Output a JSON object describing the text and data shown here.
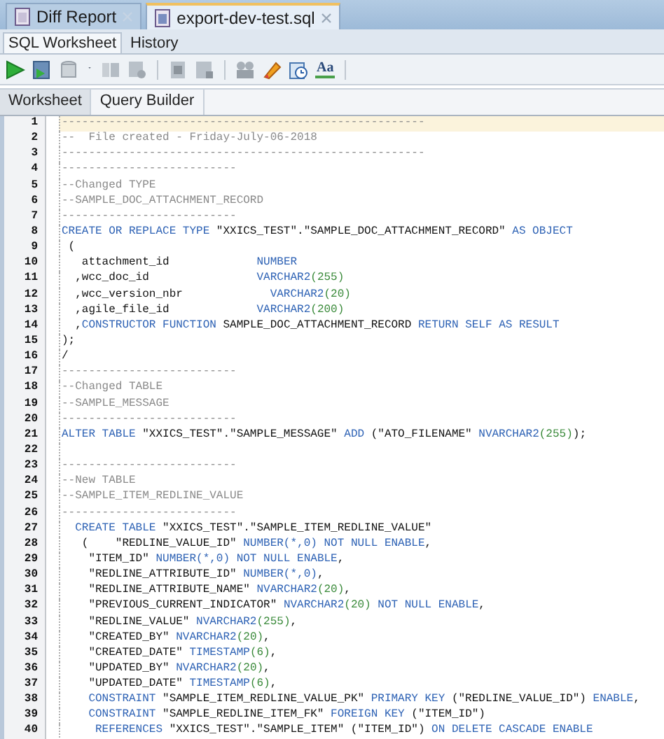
{
  "document_tabs": [
    {
      "label": "Diff Report",
      "selected": false
    },
    {
      "label": "export-dev-test.sql",
      "selected": true
    }
  ],
  "view_tabs": [
    {
      "label": "SQL Worksheet",
      "selected": true
    },
    {
      "label": "History",
      "selected": false
    }
  ],
  "toolbar": {
    "format_icon_text": "Aa"
  },
  "editor_tabs": [
    {
      "label": "Worksheet",
      "selected": true
    },
    {
      "label": "Query Builder",
      "selected": false
    }
  ],
  "editor": {
    "lines": [
      {
        "number": "1",
        "current": true,
        "tokens": [
          {
            "kind": "comment",
            "text": "------------------------------------------------------"
          }
        ]
      },
      {
        "number": "2",
        "current": false,
        "tokens": [
          {
            "kind": "comment",
            "text": "--  File created - Friday-July-06-2018"
          }
        ]
      },
      {
        "number": "3",
        "current": false,
        "tokens": [
          {
            "kind": "comment",
            "text": "------------------------------------------------------"
          }
        ]
      },
      {
        "number": "4",
        "current": false,
        "tokens": [
          {
            "kind": "comment",
            "text": "--------------------------"
          }
        ]
      },
      {
        "number": "5",
        "current": false,
        "tokens": [
          {
            "kind": "comment",
            "text": "--Changed TYPE"
          }
        ]
      },
      {
        "number": "6",
        "current": false,
        "tokens": [
          {
            "kind": "comment",
            "text": "--SAMPLE_DOC_ATTACHMENT_RECORD"
          }
        ]
      },
      {
        "number": "7",
        "current": false,
        "tokens": [
          {
            "kind": "comment",
            "text": "--------------------------"
          }
        ]
      },
      {
        "number": "8",
        "current": false,
        "tokens": [
          {
            "kind": "keyword",
            "text": "CREATE OR REPLACE TYPE "
          },
          {
            "kind": "plain",
            "text": "\"XXICS_TEST\".\"SAMPLE_DOC_ATTACHMENT_RECORD\" "
          },
          {
            "kind": "keyword",
            "text": "AS OBJECT"
          }
        ]
      },
      {
        "number": "9",
        "current": false,
        "tokens": [
          {
            "kind": "plain",
            "text": " ("
          }
        ]
      },
      {
        "number": "10",
        "current": false,
        "tokens": [
          {
            "kind": "plain",
            "text": "   attachment_id             "
          },
          {
            "kind": "keyword",
            "text": "NUMBER"
          }
        ]
      },
      {
        "number": "11",
        "current": false,
        "tokens": [
          {
            "kind": "plain",
            "text": "  ,wcc_doc_id                "
          },
          {
            "kind": "keyword",
            "text": "VARCHAR2"
          },
          {
            "kind": "number",
            "text": "(255)"
          }
        ]
      },
      {
        "number": "12",
        "current": false,
        "tokens": [
          {
            "kind": "plain",
            "text": "  ,wcc_version_nbr             "
          },
          {
            "kind": "keyword",
            "text": "VARCHAR2"
          },
          {
            "kind": "number",
            "text": "(20)"
          }
        ]
      },
      {
        "number": "13",
        "current": false,
        "tokens": [
          {
            "kind": "plain",
            "text": "  ,agile_file_id             "
          },
          {
            "kind": "keyword",
            "text": "VARCHAR2"
          },
          {
            "kind": "number",
            "text": "(200)"
          }
        ]
      },
      {
        "number": "14",
        "current": false,
        "tokens": [
          {
            "kind": "plain",
            "text": "  ,"
          },
          {
            "kind": "keyword",
            "text": "CONSTRUCTOR FUNCTION "
          },
          {
            "kind": "plain",
            "text": "SAMPLE_DOC_ATTACHMENT_RECORD "
          },
          {
            "kind": "keyword",
            "text": "RETURN SELF AS RESULT"
          }
        ]
      },
      {
        "number": "15",
        "current": false,
        "tokens": [
          {
            "kind": "plain",
            "text": ");"
          }
        ]
      },
      {
        "number": "16",
        "current": false,
        "tokens": [
          {
            "kind": "plain",
            "text": "/"
          }
        ]
      },
      {
        "number": "17",
        "current": false,
        "tokens": [
          {
            "kind": "comment",
            "text": "--------------------------"
          }
        ]
      },
      {
        "number": "18",
        "current": false,
        "tokens": [
          {
            "kind": "comment",
            "text": "--Changed TABLE"
          }
        ]
      },
      {
        "number": "19",
        "current": false,
        "tokens": [
          {
            "kind": "comment",
            "text": "--SAMPLE_MESSAGE"
          }
        ]
      },
      {
        "number": "20",
        "current": false,
        "tokens": [
          {
            "kind": "comment",
            "text": "--------------------------"
          }
        ]
      },
      {
        "number": "21",
        "current": false,
        "tokens": [
          {
            "kind": "keyword",
            "text": "ALTER TABLE "
          },
          {
            "kind": "plain",
            "text": "\"XXICS_TEST\".\"SAMPLE_MESSAGE\" "
          },
          {
            "kind": "keyword",
            "text": "ADD "
          },
          {
            "kind": "plain",
            "text": "(\"ATO_FILENAME\" "
          },
          {
            "kind": "keyword",
            "text": "NVARCHAR2"
          },
          {
            "kind": "number",
            "text": "(255)"
          },
          {
            "kind": "plain",
            "text": ");"
          }
        ]
      },
      {
        "number": "22",
        "current": false
      },
      {
        "number": "23",
        "current": false,
        "tokens": [
          {
            "kind": "comment",
            "text": "--------------------------"
          }
        ]
      },
      {
        "number": "24",
        "current": false,
        "tokens": [
          {
            "kind": "comment",
            "text": "--New TABLE"
          }
        ]
      },
      {
        "number": "25",
        "current": false,
        "tokens": [
          {
            "kind": "comment",
            "text": "--SAMPLE_ITEM_REDLINE_VALUE"
          }
        ]
      },
      {
        "number": "26",
        "current": false,
        "tokens": [
          {
            "kind": "comment",
            "text": "--------------------------"
          }
        ]
      },
      {
        "number": "27",
        "current": false,
        "tokens": [
          {
            "kind": "keyword",
            "text": "  CREATE TABLE "
          },
          {
            "kind": "plain",
            "text": "\"XXICS_TEST\".\"SAMPLE_ITEM_REDLINE_VALUE\""
          }
        ]
      },
      {
        "number": "28",
        "current": false,
        "tokens": [
          {
            "kind": "plain",
            "text": "   (    \"REDLINE_VALUE_ID\" "
          },
          {
            "kind": "keyword",
            "text": "NUMBER(*,0) NOT NULL ENABLE"
          },
          {
            "kind": "plain",
            "text": ","
          }
        ]
      },
      {
        "number": "29",
        "current": false,
        "tokens": [
          {
            "kind": "plain",
            "text": "    \"ITEM_ID\" "
          },
          {
            "kind": "keyword",
            "text": "NUMBER(*,0) NOT NULL ENABLE"
          },
          {
            "kind": "plain",
            "text": ","
          }
        ]
      },
      {
        "number": "30",
        "current": false,
        "tokens": [
          {
            "kind": "plain",
            "text": "    \"REDLINE_ATTRIBUTE_ID\" "
          },
          {
            "kind": "keyword",
            "text": "NUMBER(*,0)"
          },
          {
            "kind": "plain",
            "text": ","
          }
        ]
      },
      {
        "number": "31",
        "current": false,
        "tokens": [
          {
            "kind": "plain",
            "text": "    \"REDLINE_ATTRIBUTE_NAME\" "
          },
          {
            "kind": "keyword",
            "text": "NVARCHAR2"
          },
          {
            "kind": "number",
            "text": "(20)"
          },
          {
            "kind": "plain",
            "text": ","
          }
        ]
      },
      {
        "number": "32",
        "current": false,
        "tokens": [
          {
            "kind": "plain",
            "text": "    \"PREVIOUS_CURRENT_INDICATOR\" "
          },
          {
            "kind": "keyword",
            "text": "NVARCHAR2"
          },
          {
            "kind": "number",
            "text": "(20)"
          },
          {
            "kind": "keyword",
            "text": " NOT NULL ENABLE"
          },
          {
            "kind": "plain",
            "text": ","
          }
        ]
      },
      {
        "number": "33",
        "current": false,
        "tokens": [
          {
            "kind": "plain",
            "text": "    \"REDLINE_VALUE\" "
          },
          {
            "kind": "keyword",
            "text": "NVARCHAR2"
          },
          {
            "kind": "number",
            "text": "(255)"
          },
          {
            "kind": "plain",
            "text": ","
          }
        ]
      },
      {
        "number": "34",
        "current": false,
        "tokens": [
          {
            "kind": "plain",
            "text": "    \"CREATED_BY\" "
          },
          {
            "kind": "keyword",
            "text": "NVARCHAR2"
          },
          {
            "kind": "number",
            "text": "(20)"
          },
          {
            "kind": "plain",
            "text": ","
          }
        ]
      },
      {
        "number": "35",
        "current": false,
        "tokens": [
          {
            "kind": "plain",
            "text": "    \"CREATED_DATE\" "
          },
          {
            "kind": "keyword",
            "text": "TIMESTAMP"
          },
          {
            "kind": "number",
            "text": "(6)"
          },
          {
            "kind": "plain",
            "text": ","
          }
        ]
      },
      {
        "number": "36",
        "current": false,
        "tokens": [
          {
            "kind": "plain",
            "text": "    \"UPDATED_BY\" "
          },
          {
            "kind": "keyword",
            "text": "NVARCHAR2"
          },
          {
            "kind": "number",
            "text": "(20)"
          },
          {
            "kind": "plain",
            "text": ","
          }
        ]
      },
      {
        "number": "37",
        "current": false,
        "tokens": [
          {
            "kind": "plain",
            "text": "    \"UPDATED_DATE\" "
          },
          {
            "kind": "keyword",
            "text": "TIMESTAMP"
          },
          {
            "kind": "number",
            "text": "(6)"
          },
          {
            "kind": "plain",
            "text": ","
          }
        ]
      },
      {
        "number": "38",
        "current": false,
        "tokens": [
          {
            "kind": "keyword",
            "text": "    CONSTRAINT "
          },
          {
            "kind": "plain",
            "text": "\"SAMPLE_ITEM_REDLINE_VALUE_PK\" "
          },
          {
            "kind": "keyword",
            "text": "PRIMARY KEY "
          },
          {
            "kind": "plain",
            "text": "(\"REDLINE_VALUE_ID\") "
          },
          {
            "kind": "keyword",
            "text": "ENABLE"
          },
          {
            "kind": "plain",
            "text": ","
          }
        ]
      },
      {
        "number": "39",
        "current": false,
        "tokens": [
          {
            "kind": "keyword",
            "text": "    CONSTRAINT "
          },
          {
            "kind": "plain",
            "text": "\"SAMPLE_REDLINE_ITEM_FK\" "
          },
          {
            "kind": "keyword",
            "text": "FOREIGN KEY "
          },
          {
            "kind": "plain",
            "text": "(\"ITEM_ID\")"
          }
        ]
      },
      {
        "number": "40",
        "current": false,
        "tokens": [
          {
            "kind": "keyword",
            "text": "     REFERENCES "
          },
          {
            "kind": "plain",
            "text": "\"XXICS_TEST\".\"SAMPLE_ITEM\" (\"ITEM_ID\") "
          },
          {
            "kind": "keyword",
            "text": "ON DELETE CASCADE ENABLE"
          }
        ]
      }
    ]
  }
}
